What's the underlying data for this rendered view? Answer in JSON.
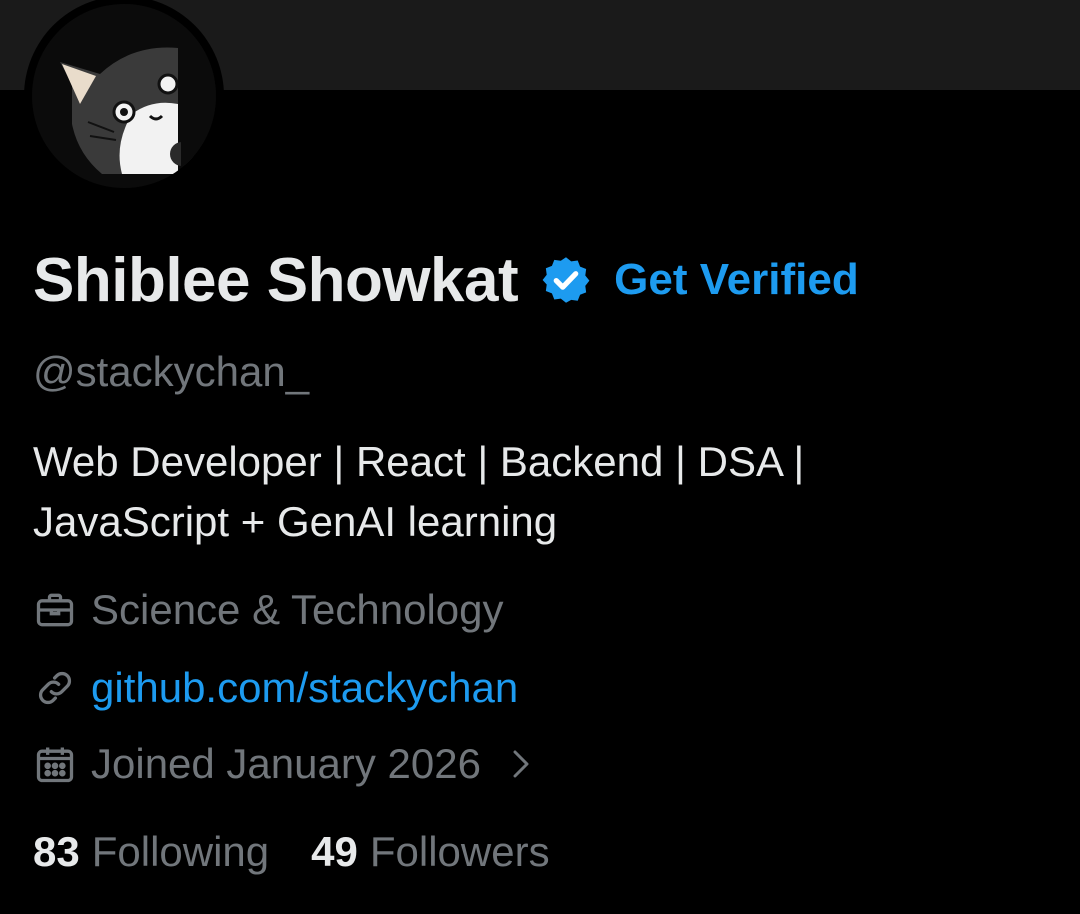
{
  "profile": {
    "display_name": "Shiblee Showkat",
    "verified_icon": "verified-badge-icon",
    "get_verified_label": "Get Verified",
    "handle": "@stackychan_",
    "bio_lines": [
      "Web Developer | React | Backend | DSA |",
      "JavaScript + GenAI learning"
    ],
    "category": "Science & Technology",
    "category_icon": "briefcase-icon",
    "website": "github.com/stackychan",
    "website_icon": "link-icon",
    "joined": "Joined January 2026",
    "joined_icon": "calendar-icon",
    "following_count": "83",
    "following_label": "Following",
    "followers_count": "49",
    "followers_label": "Followers"
  },
  "colors": {
    "background": "#000000",
    "banner": "#1a1a1a",
    "text_primary": "#e7e9ea",
    "text_secondary": "#71767b",
    "accent": "#1d9bf0"
  }
}
